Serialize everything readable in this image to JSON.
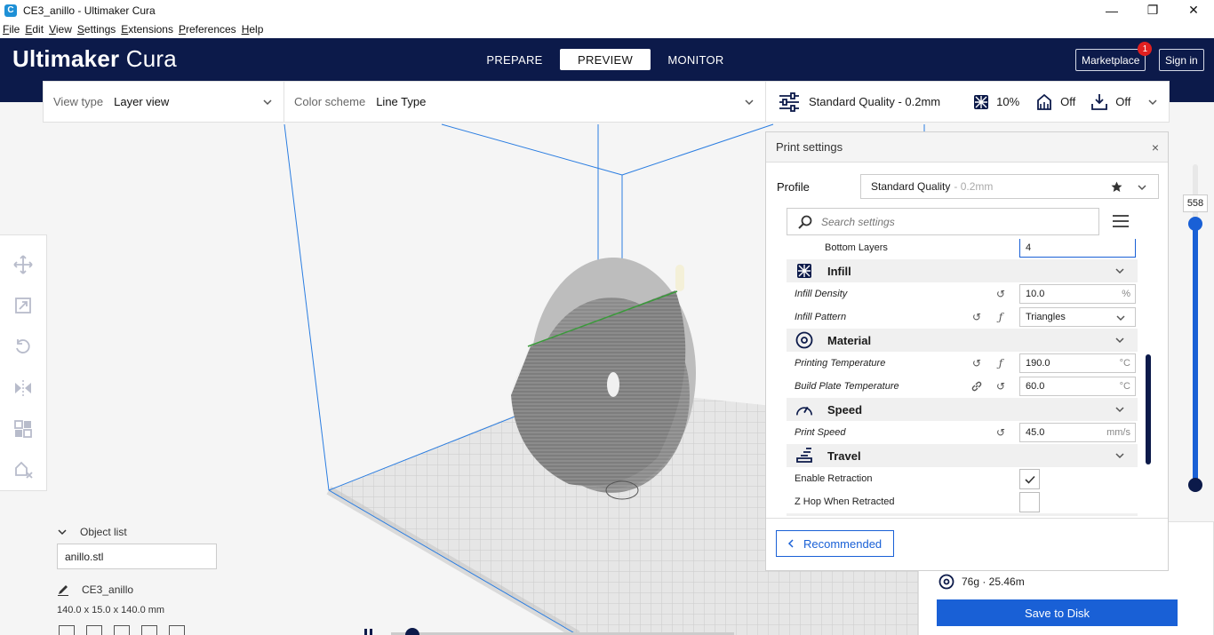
{
  "window": {
    "title": "CE3_anillo - Ultimaker Cura",
    "app_icon": "C",
    "minimize": "—",
    "maximize": "❐",
    "close": "✕"
  },
  "menu": [
    "File",
    "Edit",
    "View",
    "Settings",
    "Extensions",
    "Preferences",
    "Help"
  ],
  "header": {
    "brand_bold": "Ultimaker",
    "brand_light": "Cura",
    "tabs": [
      {
        "label": "PREPARE",
        "active": false
      },
      {
        "label": "PREVIEW",
        "active": true
      },
      {
        "label": "MONITOR",
        "active": false
      }
    ],
    "marketplace": "Marketplace",
    "marketplace_badge": "1",
    "sign_in": "Sign in"
  },
  "topbar": {
    "view_type_label": "View type",
    "view_type_value": "Layer view",
    "color_scheme_label": "Color scheme",
    "color_scheme_value": "Line Type",
    "quality": "Standard Quality - 0.2mm",
    "infill": "10%",
    "support": "Off",
    "adhesion": "Off"
  },
  "object_list": {
    "header": "Object list",
    "file": "anillo.stl",
    "name": "CE3_anillo",
    "dims": "140.0 x 15.0 x 140.0 mm"
  },
  "print_settings": {
    "title": "Print settings",
    "close": "×",
    "profile_label": "Profile",
    "profile_value": "Standard Quality",
    "profile_sub": "- 0.2mm",
    "search_placeholder": "Search settings",
    "bottom_layers_label": "Bottom Layers",
    "bottom_layers_value": "4",
    "infill_cat": "Infill",
    "infill_density_label": "Infill Density",
    "infill_density_value": "10.0",
    "infill_density_unit": "%",
    "infill_pattern_label": "Infill Pattern",
    "infill_pattern_value": "Triangles",
    "material_cat": "Material",
    "print_temp_label": "Printing Temperature",
    "print_temp_value": "190.0",
    "print_temp_unit": "°C",
    "bed_temp_label": "Build Plate Temperature",
    "bed_temp_value": "60.0",
    "bed_temp_unit": "°C",
    "speed_cat": "Speed",
    "print_speed_label": "Print Speed",
    "print_speed_value": "45.0",
    "print_speed_unit": "mm/s",
    "travel_cat": "Travel",
    "retraction_label": "Enable Retraction",
    "retraction_checked": true,
    "zhop_label": "Z Hop When Retracted",
    "zhop_checked": false,
    "recommended": "Recommended"
  },
  "layer_slider": {
    "current": "558"
  },
  "output": {
    "estimate": "76g · 25.46m",
    "save": "Save to Disk"
  },
  "colors": {
    "header_bg": "#0c1a4a",
    "accent": "#1960d6"
  }
}
